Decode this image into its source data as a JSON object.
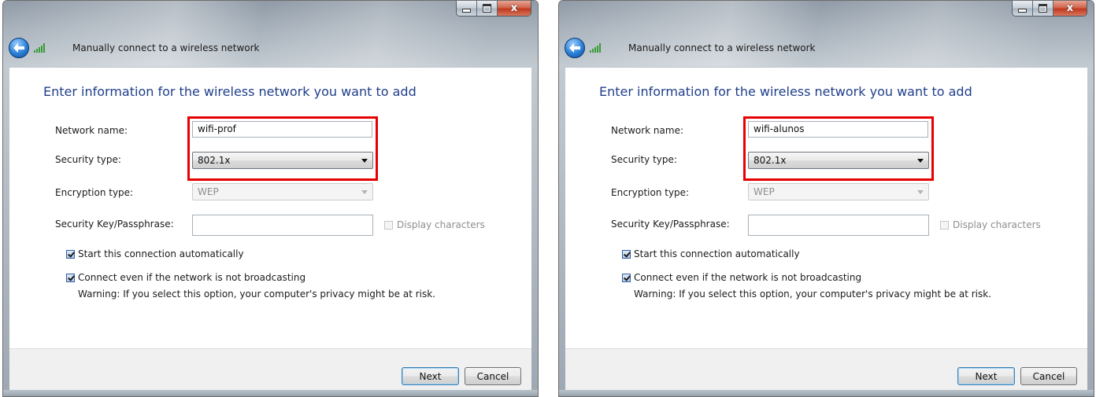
{
  "windows": [
    {
      "title": "Manually connect to a wireless network",
      "heading": "Enter information for the wireless network you want to add",
      "network_name_label": "Network name:",
      "network_name_value": "wifi-prof",
      "security_type_label": "Security type:",
      "security_type_value": "802.1x",
      "encryption_type_label": "Encryption type:",
      "encryption_type_value": "WEP",
      "passphrase_label": "Security Key/Passphrase:",
      "passphrase_value": "",
      "display_characters_label": "Display characters",
      "display_characters_checked": false,
      "auto_connect_label": "Start this connection automatically",
      "auto_connect_checked": true,
      "not_broadcasting_label": "Connect even if the network is not broadcasting",
      "not_broadcasting_checked": true,
      "warning_text": "Warning: If you select this option, your computer's privacy might be at risk.",
      "next_label": "Next",
      "cancel_label": "Cancel",
      "close_glyph": "x"
    },
    {
      "title": "Manually connect to a wireless network",
      "heading": "Enter information for the wireless network you want to add",
      "network_name_label": "Network name:",
      "network_name_value": "wifi-alunos",
      "security_type_label": "Security type:",
      "security_type_value": "802.1x",
      "encryption_type_label": "Encryption type:",
      "encryption_type_value": "WEP",
      "passphrase_label": "Security Key/Passphrase:",
      "passphrase_value": "",
      "display_characters_label": "Display characters",
      "display_characters_checked": false,
      "auto_connect_label": "Start this connection automatically",
      "auto_connect_checked": true,
      "not_broadcasting_label": "Connect even if the network is not broadcasting",
      "not_broadcasting_checked": true,
      "warning_text": "Warning: If you select this option, your computer's privacy might be at risk.",
      "next_label": "Next",
      "cancel_label": "Cancel",
      "close_glyph": "x"
    }
  ],
  "colors": {
    "heading": "#1f3e8a",
    "highlight": "#e60000",
    "close_button": "#c0391f"
  },
  "icons": [
    "back-arrow-icon",
    "wireless-signal-icon",
    "minimize-icon",
    "maximize-icon",
    "close-icon"
  ]
}
